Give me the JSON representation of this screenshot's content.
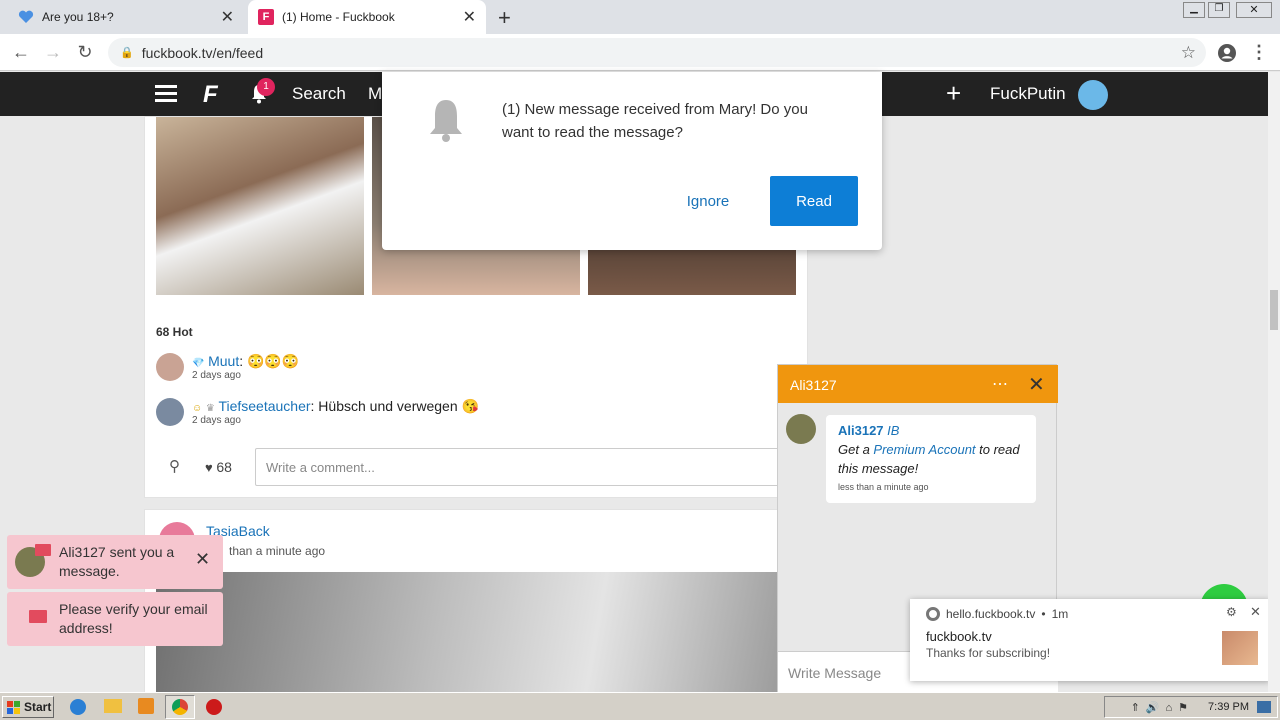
{
  "browser": {
    "tabs": [
      {
        "title": "Are you 18+?",
        "icon": "heart-icon"
      },
      {
        "title": "(1) Home - Fuckbook",
        "icon": "site-favicon"
      }
    ],
    "new_tab": "+",
    "url": "fuckbook.tv/en/feed"
  },
  "header": {
    "search_label": "Search",
    "partial_label": "M",
    "notification_count": "1",
    "plus": "+",
    "username": "FuckPutin"
  },
  "notification": {
    "message": "(1) New message received from Mary! Do you want to read the message?",
    "ignore_label": "Ignore",
    "read_label": "Read"
  },
  "feed": {
    "hot_count": "68 Hot",
    "comments": [
      {
        "user": "Muut",
        "text": ": 😳😳😳",
        "time": "2 days ago"
      },
      {
        "user": "Tiefseetaucher",
        "text": ": Hübsch und verwegen 😘",
        "time": "2 days ago"
      }
    ],
    "like_count": "68",
    "comment_placeholder": "Write a comment...",
    "next_post_user": "TasiaBack",
    "next_post_time": "than a minute ago"
  },
  "chat": {
    "title": "Ali3127",
    "sender": "Ali3127",
    "sender_tag": "IB",
    "body_pre": "Get a ",
    "body_link": "Premium Account",
    "body_post": " to read this message!",
    "time": "less than a minute ago",
    "input_placeholder": "Write Message"
  },
  "toasts": [
    {
      "text": "Ali3127 sent you a message."
    },
    {
      "text": "Please verify your email address!"
    }
  ],
  "chrome_notification": {
    "source": "hello.fuckbook.tv",
    "age": "1m",
    "title": "fuckbook.tv",
    "body": "Thanks for subscribing!"
  },
  "taskbar": {
    "start_label": "Start",
    "clock": "7:39 PM"
  },
  "colors": {
    "chat_header": "#f0960e",
    "read_button": "#0d7ed6",
    "toast_bg": "#f6c6cf",
    "site_header": "#222222"
  }
}
